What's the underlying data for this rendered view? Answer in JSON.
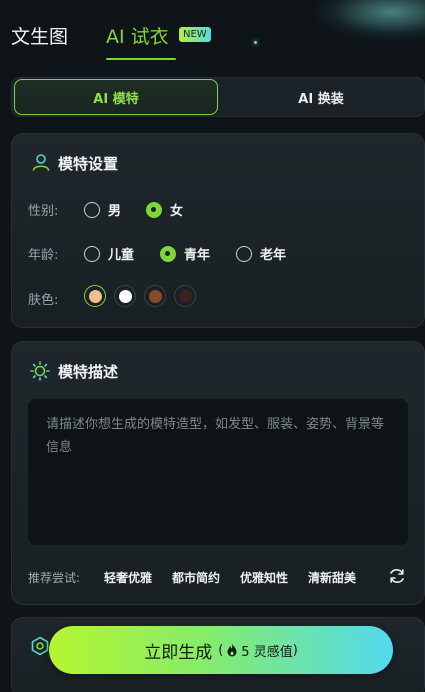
{
  "header": {
    "tab_text2img": "文生图",
    "tab_tryon": "AI 试衣",
    "new_badge": "NEW"
  },
  "segment": {
    "model_label": "AI 模特",
    "swap_label": "AI 换装",
    "selected": "AI 模特"
  },
  "model_settings": {
    "title": "模特设置",
    "gender_label": "性别:",
    "gender_options": [
      "男",
      "女"
    ],
    "gender_selected": "女",
    "age_label": "年龄:",
    "age_options": [
      "儿童",
      "青年",
      "老年"
    ],
    "age_selected": "青年",
    "skin_label": "肤色:",
    "skin_colors": [
      "#f2c08c",
      "#ffffff",
      "#8a4a2a",
      "#3a2220"
    ],
    "skin_selected_index": 0
  },
  "model_desc": {
    "title": "模特描述",
    "placeholder": "请描述你想生成的模特造型，如发型、服装、姿势、背景等信息",
    "suggest_label": "推荐尝试:",
    "suggestions": [
      "轻奢优雅",
      "都市简约",
      "优雅知性",
      "清新甜美"
    ]
  },
  "generate": {
    "label": "立即生成",
    "cost": "5 灵感值"
  },
  "colors": {
    "accent": "#7dd63a",
    "background": "#0e1418"
  }
}
